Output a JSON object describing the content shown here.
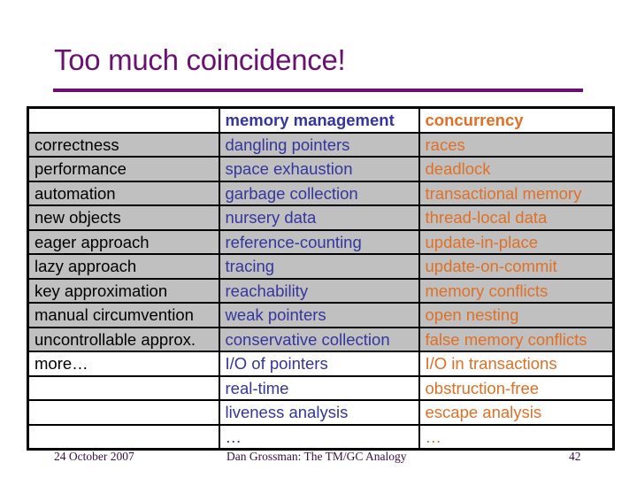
{
  "slide": {
    "title": "Too much coincidence!",
    "colors": {
      "title": "#6b1172",
      "memory_management": "#35359e",
      "concurrency": "#e07026",
      "row_fill": "#c0c0c0"
    }
  },
  "table": {
    "header": [
      "",
      "memory management",
      "concurrency"
    ],
    "rows": [
      {
        "aspect": "correctness",
        "memory_management": "dangling pointers",
        "concurrency": "races",
        "shaded": true
      },
      {
        "aspect": "performance",
        "memory_management": "space exhaustion",
        "concurrency": "deadlock",
        "shaded": true
      },
      {
        "aspect": "automation",
        "memory_management": "garbage collection",
        "concurrency": "transactional memory",
        "shaded": true
      },
      {
        "aspect": "new objects",
        "memory_management": "nursery data",
        "concurrency": "thread-local data",
        "shaded": true
      },
      {
        "aspect": "eager approach",
        "memory_management": "reference-counting",
        "concurrency": "update-in-place",
        "shaded": true
      },
      {
        "aspect": "lazy approach",
        "memory_management": "tracing",
        "concurrency": "update-on-commit",
        "shaded": true
      },
      {
        "aspect": "key approximation",
        "memory_management": "reachability",
        "concurrency": "memory conflicts",
        "shaded": true
      },
      {
        "aspect": "manual circumvention",
        "memory_management": "weak pointers",
        "concurrency": "open nesting",
        "shaded": true
      },
      {
        "aspect": "uncontrollable approx.",
        "memory_management": "conservative collection",
        "concurrency": "false memory conflicts",
        "shaded": true
      },
      {
        "aspect": "more…",
        "memory_management": "I/O of pointers",
        "concurrency": "I/O in transactions",
        "shaded": false
      },
      {
        "aspect": "",
        "memory_management": "real-time",
        "concurrency": "obstruction-free",
        "shaded": false
      },
      {
        "aspect": "",
        "memory_management": "liveness analysis",
        "concurrency": "escape analysis",
        "shaded": false
      },
      {
        "aspect": "",
        "memory_management": "…",
        "concurrency": "…",
        "shaded": false
      }
    ]
  },
  "footer": {
    "date": "24 October 2007",
    "presentation": "Dan Grossman: The TM/GC Analogy",
    "page_number": "42"
  }
}
